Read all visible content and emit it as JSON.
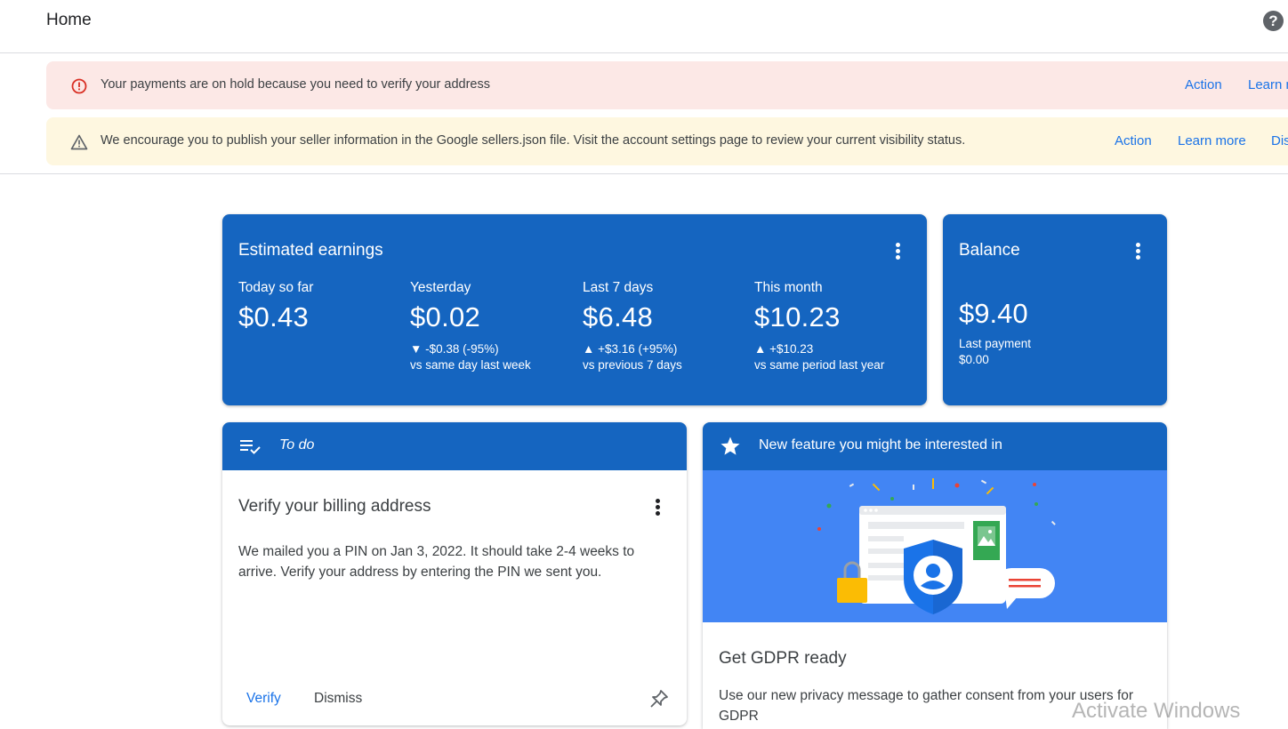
{
  "header": {
    "title": "Home",
    "help_icon": "help-circle-icon",
    "help_glyph": "?"
  },
  "banners": {
    "payment_hold": {
      "icon": "error-icon",
      "text": "Your payments are on hold because you need to verify your address",
      "action": "Action",
      "learn": "Learn m"
    },
    "sellers_json": {
      "icon": "warning-icon",
      "text": "We encourage you to publish your seller information in the Google sellers.json file. Visit the account settings page to review your current visibility status.",
      "action": "Action",
      "learn": "Learn more",
      "dismiss": "Dis"
    }
  },
  "earnings": {
    "title": "Estimated earnings",
    "metrics": [
      {
        "label": "Today so far",
        "value": "$0.43",
        "change": "",
        "sub": ""
      },
      {
        "label": "Yesterday",
        "value": "$0.02",
        "change": "▼ -$0.38 (-95%)",
        "sub": "vs same day last week"
      },
      {
        "label": "Last 7 days",
        "value": "$6.48",
        "change": "▲ +$3.16 (+95%)",
        "sub": "vs previous 7 days"
      },
      {
        "label": "This month",
        "value": "$10.23",
        "change": "▲ +$10.23",
        "sub": "vs same period last year"
      }
    ]
  },
  "balance": {
    "title": "Balance",
    "value": "$9.40",
    "last_payment_label": "Last payment",
    "last_payment_value": "$0.00"
  },
  "todo": {
    "header": "To do",
    "icon": "checklist-icon",
    "task_title": "Verify your billing address",
    "body": "We mailed you a PIN on Jan 3, 2022. It should take 2-4 weeks to arrive. Verify your address by entering the PIN we sent you.",
    "verify": "Verify",
    "dismiss": "Dismiss",
    "pin_icon": "pin-icon"
  },
  "feature": {
    "header": "New feature you might be interested in",
    "icon": "star-icon",
    "title": "Get GDPR ready",
    "body": "Use our new privacy message to gather consent from your users for GDPR"
  },
  "watermark": "Activate Windows",
  "colors": {
    "accent": "#1565c0",
    "link": "#1a73e8",
    "error_bg": "#fce8e6",
    "warn_bg": "#fef7e0",
    "illustration_bg": "#4285f4"
  }
}
